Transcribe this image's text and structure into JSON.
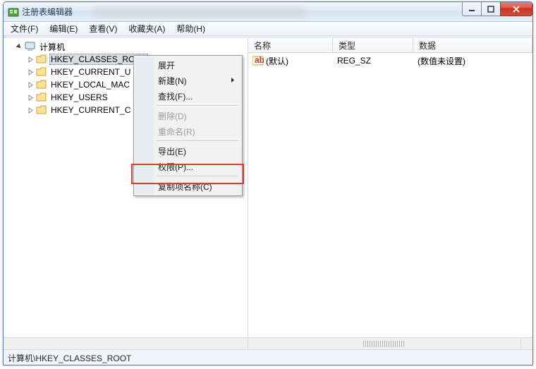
{
  "window": {
    "title": "注册表编辑器"
  },
  "menu": {
    "file": "文件(F)",
    "edit": "编辑(E)",
    "view": "查看(V)",
    "favorites": "收藏夹(A)",
    "help": "帮助(H)"
  },
  "tree": {
    "root": "计算机",
    "items": [
      "HKEY_CLASSES_ROOT",
      "HKEY_CURRENT_U",
      "HKEY_LOCAL_MAC",
      "HKEY_USERS",
      "HKEY_CURRENT_C"
    ]
  },
  "list": {
    "headers": {
      "name": "名称",
      "type": "类型",
      "data": "数据"
    },
    "rows": [
      {
        "name": "(默认)",
        "type": "REG_SZ",
        "data": "(数值未设置)"
      }
    ]
  },
  "context": {
    "expand": "展开",
    "new": "新建(N)",
    "find": "查找(F)...",
    "delete": "删除(D)",
    "rename": "重命名(R)",
    "export": "导出(E)",
    "permissions": "权限(P)...",
    "copyKeyName": "复制项名称(C)"
  },
  "status": {
    "path": "计算机\\HKEY_CLASSES_ROOT"
  }
}
